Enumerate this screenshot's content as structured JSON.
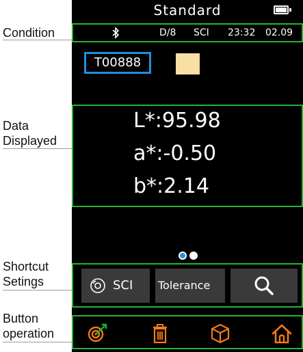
{
  "annotations": {
    "condition": "Condition",
    "data_line1": "Data",
    "data_line2": "Displayed",
    "shortcut_line1": "Shortcut",
    "shortcut_line2": "Setings",
    "button_line1": "Button",
    "button_line2": "operation"
  },
  "screen": {
    "title": "Standard",
    "status": {
      "bluetooth_icon": "bluetooth-icon",
      "geometry": "D/8",
      "mode": "SCI",
      "time": "23:32",
      "date": "02.09"
    },
    "sample": {
      "id": "T00888",
      "swatch_color": "#f7dfa6"
    },
    "readings": {
      "L": "L*:95.98",
      "a": "a*:-0.50",
      "b": "b*:2.14"
    },
    "pager": {
      "pages": 2,
      "active": 1
    },
    "shortcuts": {
      "sci": "SCI",
      "tolerance": "Tolerance",
      "search_icon": "search-icon"
    },
    "bottom_icons": [
      "target-icon",
      "trash-icon",
      "cube-icon",
      "home-icon"
    ]
  },
  "colors": {
    "frame": "#22b535",
    "accent": "#1e90e0",
    "icon_orange": "#f07a1a",
    "button_bg": "#3a3a3a"
  }
}
